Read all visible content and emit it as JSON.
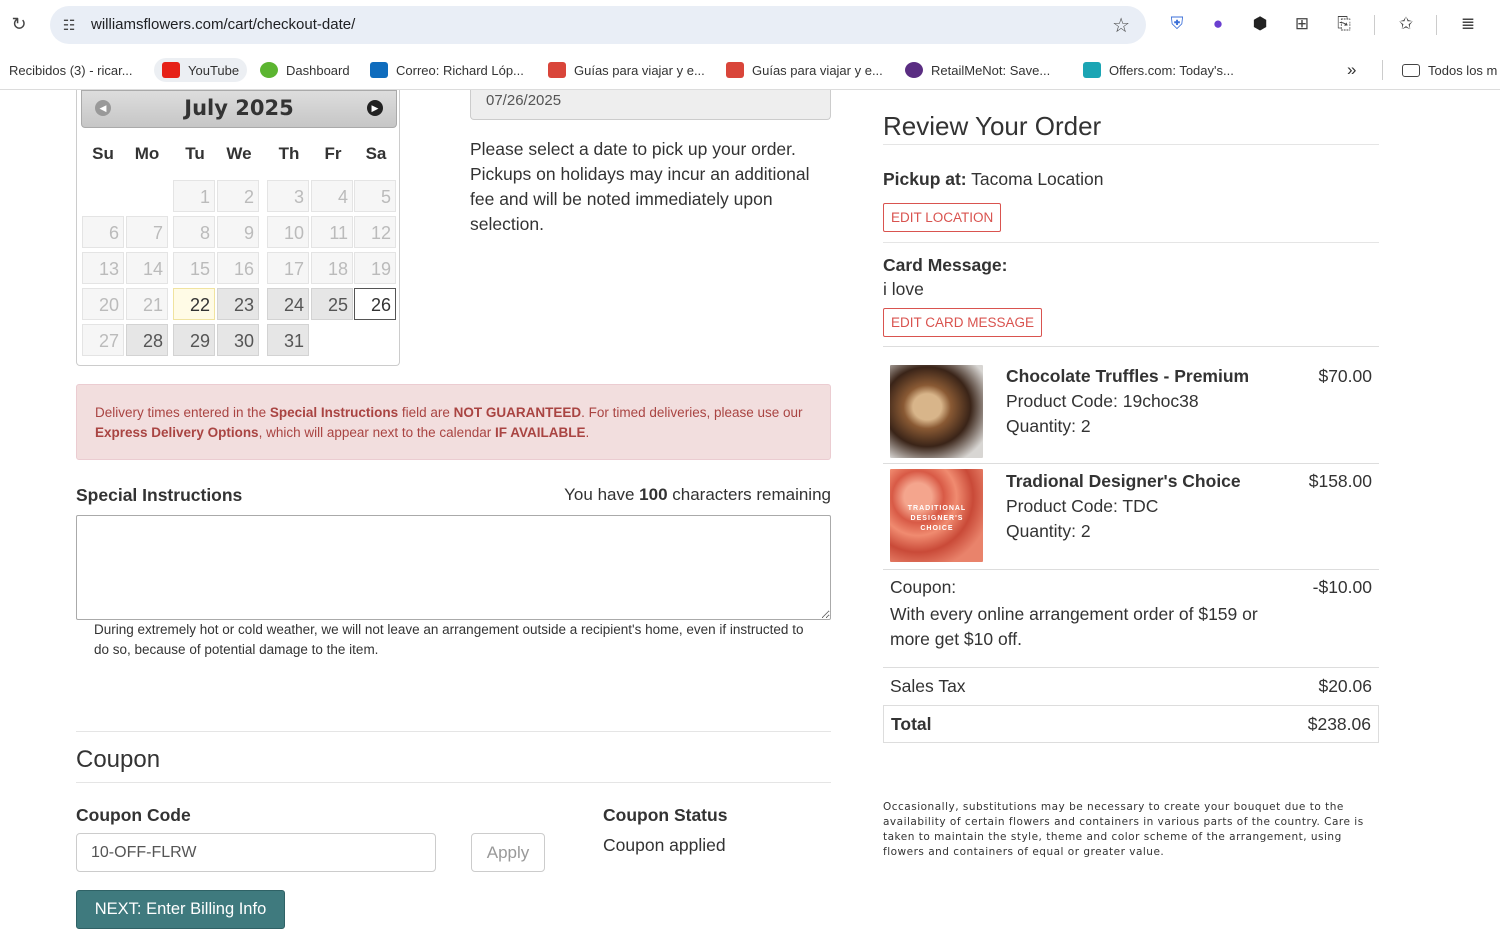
{
  "browser": {
    "url": "williamsflowers.com/cart/checkout-date/",
    "bookmarks": [
      {
        "label": "Recibidos (3) - ricar...",
        "color": ""
      },
      {
        "label": "YouTube",
        "color": "#e62117"
      },
      {
        "label": "Dashboard",
        "color": "#5cb531"
      },
      {
        "label": "Correo: Richard Lóp...",
        "color": "#0f6cbd"
      },
      {
        "label": "Guías para viajar y e...",
        "color": "#d9453a"
      },
      {
        "label": "Guías para viajar y e...",
        "color": "#d9453a"
      },
      {
        "label": "RetailMeNot: Save...",
        "color": "#5a2d82"
      },
      {
        "label": "Offers.com: Today's...",
        "color": "#1ba5b4"
      }
    ],
    "overflow_label": "»",
    "all_bookmarks_label": "Todos los m"
  },
  "calendar": {
    "month_title": "July 2025",
    "weekdays": [
      "Su",
      "Mo",
      "Tu",
      "We",
      "Th",
      "Fr",
      "Sa"
    ],
    "weeks": [
      [
        "",
        "",
        "1",
        "2",
        "3",
        "4",
        "5"
      ],
      [
        "6",
        "7",
        "8",
        "9",
        "10",
        "11",
        "12"
      ],
      [
        "13",
        "14",
        "15",
        "16",
        "17",
        "18",
        "19"
      ],
      [
        "20",
        "21",
        "22",
        "23",
        "24",
        "25",
        "26"
      ],
      [
        "27",
        "28",
        "29",
        "30",
        "31",
        "",
        ""
      ]
    ],
    "available_days": [
      "23",
      "24",
      "25",
      "28",
      "29",
      "30",
      "31"
    ],
    "today": "22",
    "selected": "26"
  },
  "date_field": "07/26/2025",
  "pickup_note": "Please select a date to pick up your order. Pickups on holidays may incur an additional fee and will be noted immediately upon selection.",
  "alert": {
    "p1": "Delivery times entered in the ",
    "b1": "Special Instructions",
    "p2": " field are ",
    "b2": "NOT GUARANTEED",
    "p3": ". For timed deliveries, please use our ",
    "b3": "Express Delivery Options",
    "p4": ", which will appear next to the calendar ",
    "b4": "IF AVAILABLE",
    "p5": "."
  },
  "special_instructions": {
    "label": "Special Instructions",
    "remaining_pre": "You have ",
    "remaining_count": "100",
    "remaining_post": " characters remaining",
    "value": ""
  },
  "weather_note": "During extremely hot or cold weather, we will not leave an arrangement outside a recipient's home, even if instructed to do so, because of potential damage to the item.",
  "coupon": {
    "heading": "Coupon",
    "code_label": "Coupon Code",
    "code_value": "10-OFF-FLRW",
    "apply_label": "Apply",
    "status_label": "Coupon Status",
    "status_value": "Coupon applied"
  },
  "next_button": "NEXT: Enter Billing Info",
  "review": {
    "heading": "Review Your Order",
    "pickup_label": "Pickup at:",
    "pickup_value": " Tacoma Location",
    "edit_location": "EDIT LOCATION",
    "card_label": "Card Message:",
    "card_text": "i love",
    "edit_card": "EDIT CARD MESSAGE",
    "items": [
      {
        "name": "Chocolate Truffles - Premium",
        "code": "Product Code: 19choc38",
        "qty": "Quantity: 2",
        "price": "$70.00"
      },
      {
        "name": "Tradional Designer's Choice",
        "code": "Product Code: TDC",
        "qty": "Quantity: 2",
        "price": "$158.00",
        "thumb_text": "TRADITIONAL DESIGNER'S CHOICE"
      }
    ],
    "coupon_label": "Coupon:",
    "coupon_desc": "With every online arrangement order of $159 or more get $10 off.",
    "coupon_amount": "-$10.00",
    "tax_label": "Sales Tax",
    "tax_value": "$20.06",
    "total_label": "Total",
    "total_value": "$238.06",
    "small_print": "Occasionally, substitutions may be necessary to create your bouquet due to the availability of certain flowers and containers in various parts of the country. Care is taken to maintain the style, theme and color scheme of the arrangement, using flowers and containers of equal or greater value."
  }
}
